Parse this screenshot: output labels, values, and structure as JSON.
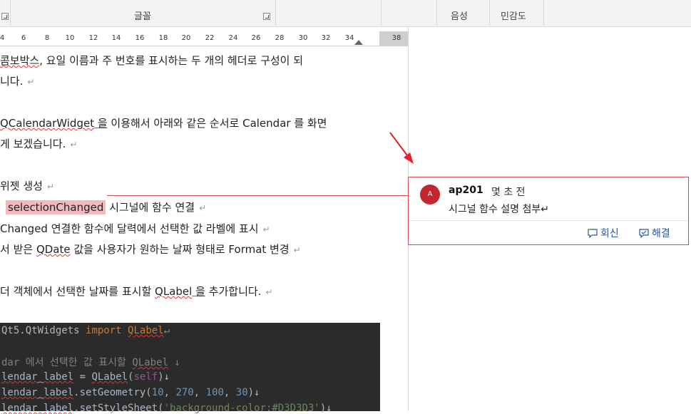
{
  "ribbon": {
    "group_font": "글꼴",
    "group_voice": "음성",
    "group_sensitivity": "민감도"
  },
  "ruler": {
    "ticks": [
      "4",
      "6",
      "8",
      "10",
      "12",
      "14",
      "16",
      "18",
      "20",
      "22",
      "24",
      "26",
      "28",
      "30",
      "32",
      "34",
      "38"
    ]
  },
  "document": {
    "line1": {
      "a": "콤보박스",
      "b": ", 요일 이름과 주 번호를 표시하는 두 개의 헤더로 구성이 되"
    },
    "line2": "니다.",
    "line3": {
      "a": "QCalendarWidget",
      "b": " 을",
      "c": " 이용해서 아래와 같은 순서로 Calendar 를 화면"
    },
    "line4": "게 보겠습니다.",
    "line5": "위젯 생성",
    "line6": {
      "a": "selectionChanged",
      "b": " 시그널에 함수 연결"
    },
    "line7": {
      "a": "Changed",
      "b": " 연결한 함수에 달력에서 선택한 값 라벨에 표시"
    },
    "line8": {
      "a": "서 받은 ",
      "b": "QDate",
      "c": " 값을 사용자가 원하는 날짜 형태로 Format 변경"
    },
    "line9": {
      "a": "더 객체에서 선택한 날짜를 표시할 ",
      "b": "QLabel",
      "c": " 을",
      "d": " 추가합니다."
    },
    "pilcrow": "↵"
  },
  "code": {
    "line1": {
      "a": "Qt5.QtWidgets ",
      "b": "import ",
      "c": "QLabel",
      "d": "↵"
    },
    "line2": {
      "a": "dar 에서 선택한 값 표시할 ",
      "b": "QLabel",
      "c": " ↓"
    },
    "line3": {
      "a": "lendar_label",
      "b": " = ",
      "c": "QLabel",
      "d": "(",
      "e": "self",
      "f": ")↓"
    },
    "line4": {
      "a": "lendar_label",
      "b": ".setGeometry(",
      "c": "10",
      "d": ", ",
      "e": "270",
      "f": ", ",
      "g": "100",
      "h": ", ",
      "i": "30",
      "j": ")↓"
    },
    "line5": {
      "a": "lendar_label",
      "b": ".setStyleSheet(",
      "c": "'background-color:#D3D3D3'",
      "d": ")↓"
    }
  },
  "comment": {
    "avatar_letter": "A",
    "author": "ap201",
    "time": "몇 초 전",
    "text": "시그널 함수 설명 첨부↵",
    "reply_label": "회신",
    "resolve_label": "해결"
  },
  "colors": {
    "comment_border": "#d64550",
    "highlight": "#f2b9be",
    "arrow": "#e8202a",
    "code_bg": "#2b2b2b"
  }
}
